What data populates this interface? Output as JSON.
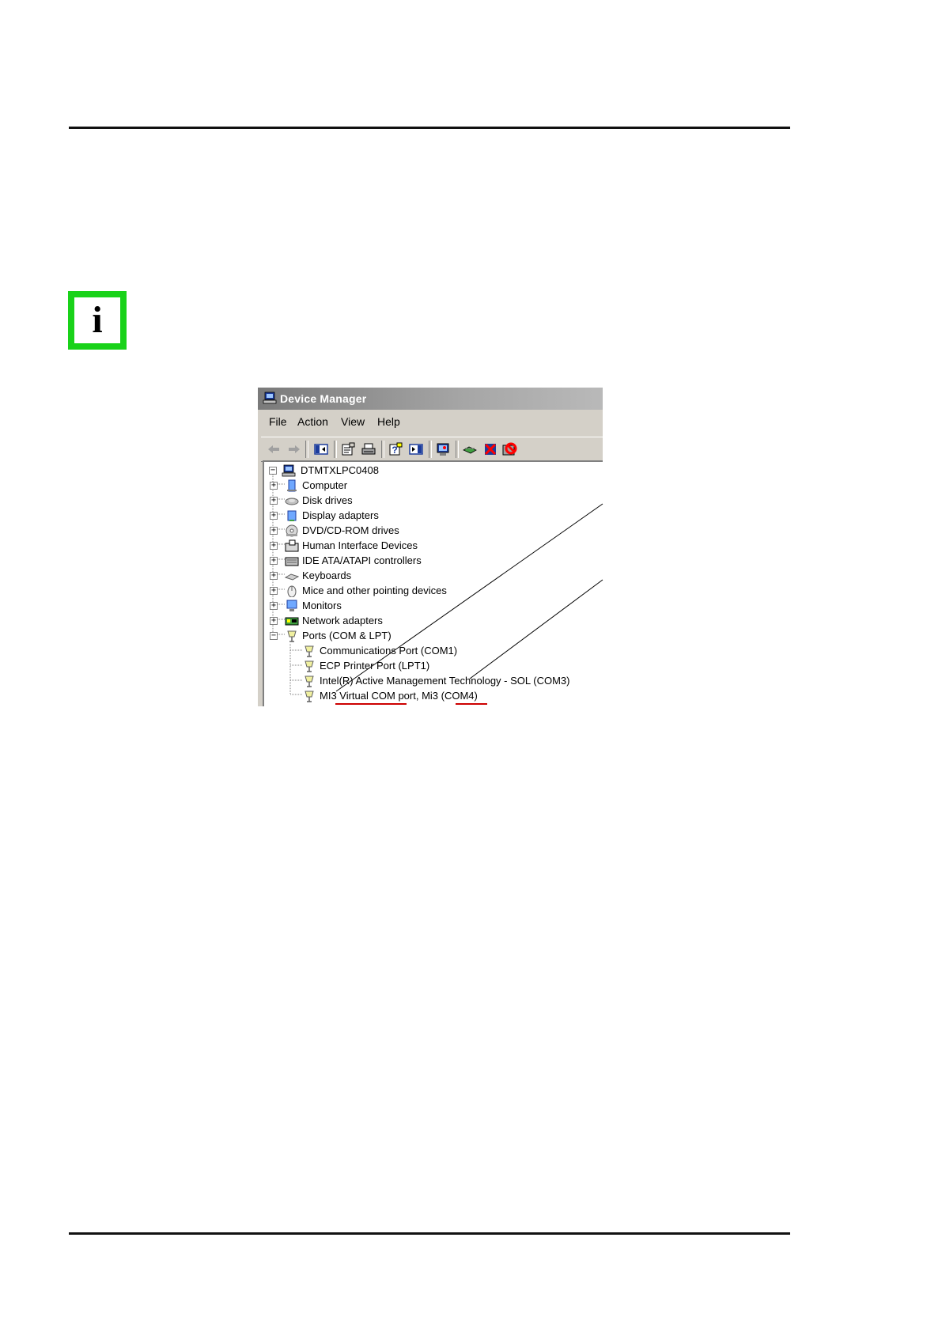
{
  "window": {
    "title": "Device Manager",
    "menu": [
      "File",
      "Action",
      "View",
      "Help"
    ],
    "toolbar_icons": [
      "back-arrow-icon",
      "forward-arrow-icon",
      "show-hide-tree-icon",
      "properties-icon",
      "print-icon",
      "help-icon",
      "show-hide-action-pane-icon",
      "scan-hardware-icon",
      "update-driver-icon",
      "uninstall-icon",
      "disable-icon"
    ]
  },
  "tree": {
    "root": "DTMTXLPC0408",
    "categories": [
      {
        "label": "Computer",
        "icon": "computer-icon",
        "expanded": false
      },
      {
        "label": "Disk drives",
        "icon": "disk-drive-icon",
        "expanded": false
      },
      {
        "label": "Display adapters",
        "icon": "display-adapter-icon",
        "expanded": false
      },
      {
        "label": "DVD/CD-ROM drives",
        "icon": "dvd-drive-icon",
        "expanded": false
      },
      {
        "label": "Human Interface Devices",
        "icon": "hid-icon",
        "expanded": false
      },
      {
        "label": "IDE ATA/ATAPI controllers",
        "icon": "ide-controller-icon",
        "expanded": false
      },
      {
        "label": "Keyboards",
        "icon": "keyboard-icon",
        "expanded": false
      },
      {
        "label": "Mice and other pointing devices",
        "icon": "mouse-icon",
        "expanded": false
      },
      {
        "label": "Monitors",
        "icon": "monitor-icon",
        "expanded": false
      },
      {
        "label": "Network adapters",
        "icon": "network-adapter-icon",
        "expanded": false
      },
      {
        "label": "Ports (COM & LPT)",
        "icon": "port-icon",
        "expanded": true
      }
    ],
    "ports": [
      "Communications Port (COM1)",
      "ECP Printer Port (LPT1)",
      "Intel(R) Active Management Technology - SOL (COM3)",
      "MI3 Virtual COM port, Mi3 (COM4)"
    ]
  },
  "colors": {
    "info_border": "#19d219",
    "underline": "#cc0000"
  }
}
